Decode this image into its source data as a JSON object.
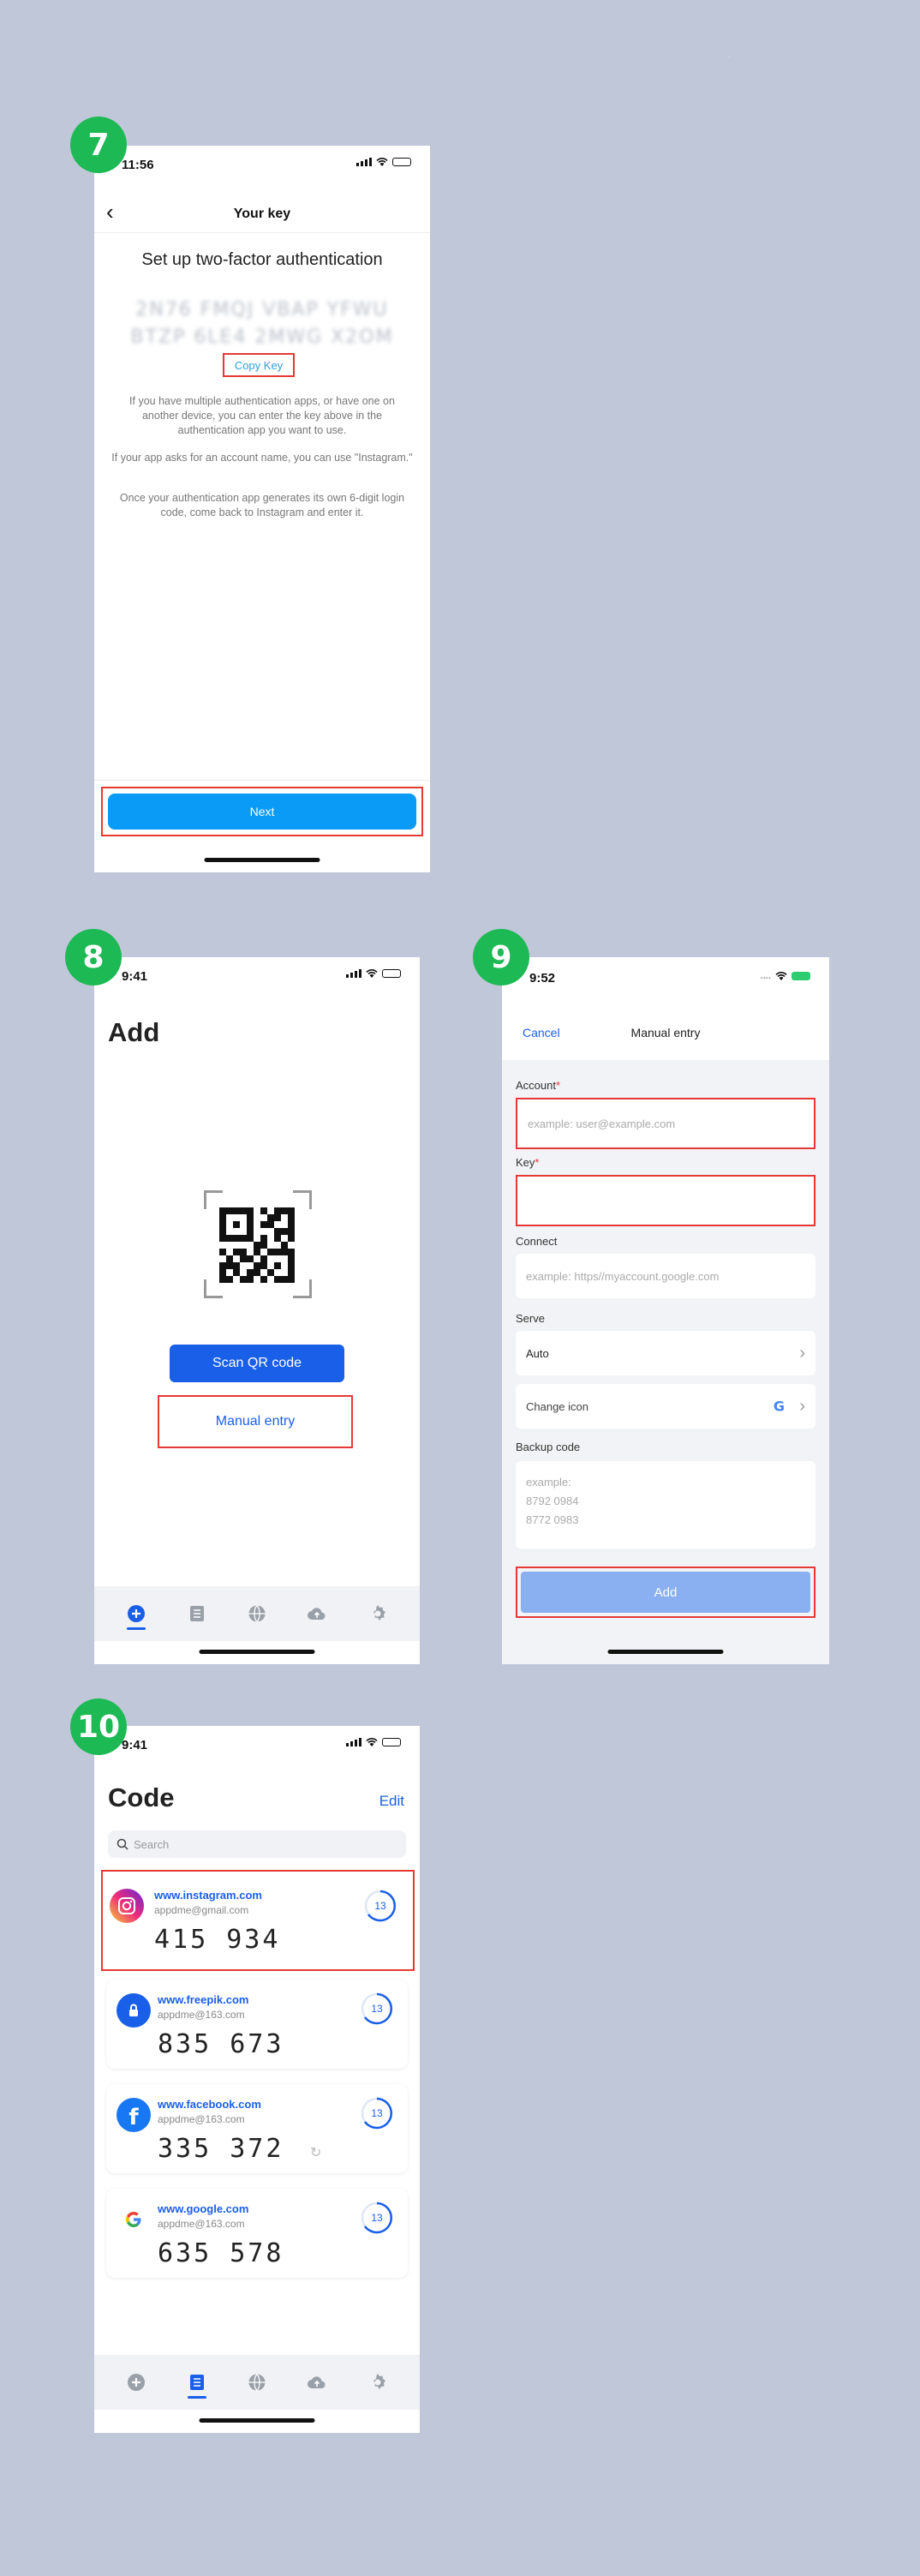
{
  "colors": {
    "accent": "#1a5fe8",
    "highlight": "#e53935",
    "badge": "#1db954",
    "background": "#bfc7d8"
  },
  "screen7": {
    "step": "7",
    "time": "11:56",
    "title": "Your key",
    "heading": "Set up two-factor authentication",
    "key_line1": "2N76 FMQJ VBAP YFWU",
    "key_line2": "BTZP 6LE4 2MWG X2OM",
    "copy_key": "Copy Key",
    "p1": "If you have multiple authentication apps, or have one on another device, you can enter the key above in the authentication app you want to use.",
    "p2": "If your app asks for an account name, you can use \"Instagram.\"",
    "p3": "Once your authentication app generates its own 6-digit login code, come back to Instagram and enter it.",
    "next": "Next"
  },
  "screen8": {
    "step": "8",
    "time": "9:41",
    "title": "Add",
    "scan_qr": "Scan QR code",
    "manual_entry": "Manual entry",
    "tabs": [
      "add-icon",
      "list-icon",
      "globe-icon",
      "cloud-upload-icon",
      "gear-icon"
    ],
    "active_tab": "add-icon"
  },
  "screen9": {
    "step": "9",
    "time": "9:52",
    "cancel": "Cancel",
    "title": "Manual entry",
    "account_label": "Account",
    "account_placeholder": "example: user@example.com",
    "key_label": "Key",
    "connect_label": "Connect",
    "connect_placeholder": "example: https//myaccount.google.com",
    "serve_label": "Serve",
    "serve_value": "Auto",
    "change_icon": "Change icon",
    "backup_label": "Backup code",
    "backup_line1": "example:",
    "backup_line2": "8792 0984",
    "backup_line3": "8772 0983",
    "add": "Add"
  },
  "screen10": {
    "step": "10",
    "time": "9:41",
    "title": "Code",
    "edit": "Edit",
    "search_placeholder": "Search",
    "cards": [
      {
        "site": "www.instagram.com",
        "account": "appdme@gmail.com",
        "code": "415 934",
        "timer": "13",
        "icon": "instagram-icon"
      },
      {
        "site": "www.freepik.com",
        "account": "appdme@163.com",
        "code": "835 673",
        "timer": "13",
        "icon": "lock-icon"
      },
      {
        "site": "www.facebook.com",
        "account": "appdme@163.com",
        "code": "335 372",
        "timer": "13",
        "icon": "facebook-icon"
      },
      {
        "site": "www.google.com",
        "account": "appdme@163.com",
        "code": "635 578",
        "timer": "13",
        "icon": "google-icon"
      }
    ],
    "active_tab": "list-icon"
  }
}
